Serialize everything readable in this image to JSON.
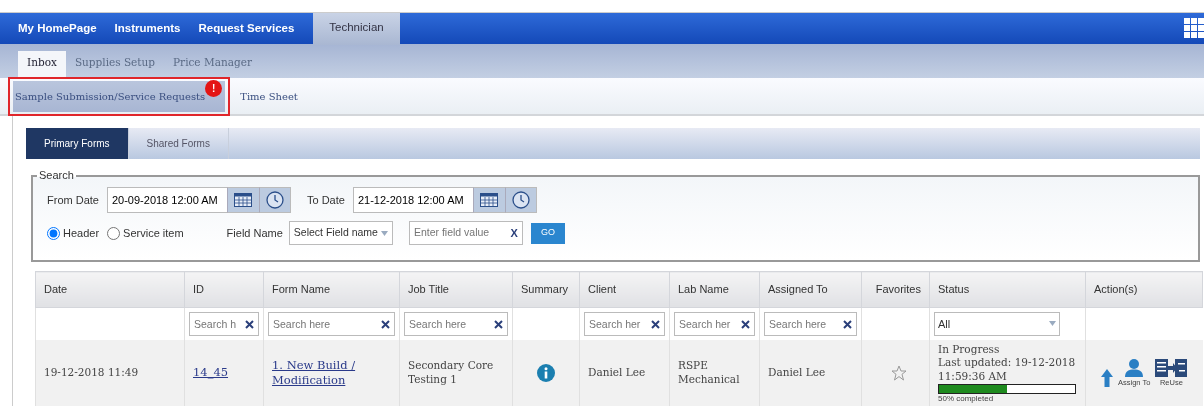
{
  "top_nav": [
    {
      "label": "My HomePage",
      "selected": false
    },
    {
      "label": "Instruments",
      "selected": false
    },
    {
      "label": "Request Services",
      "selected": false
    },
    {
      "label": "Technician",
      "selected": true
    }
  ],
  "sub_nav": [
    {
      "label": "Inbox",
      "selected": true
    },
    {
      "label": "Supplies Setup",
      "selected": false
    },
    {
      "label": "Price Manager",
      "selected": false
    }
  ],
  "section_tabs": [
    {
      "label": "Sample Submission/Service Requests",
      "selected": true,
      "badge": "!",
      "highlighted": true
    },
    {
      "label": "Time Sheet",
      "selected": false,
      "highlighted": false
    }
  ],
  "form_tabs": [
    {
      "label": "Primary Forms",
      "selected": true
    },
    {
      "label": "Shared Forms",
      "selected": false
    }
  ],
  "search": {
    "legend": "Search",
    "from_label": "From Date",
    "from_value": "20-09-2018 12:00 AM",
    "to_label": "To Date",
    "to_value": "21-12-2018 12:00 AM",
    "scope": [
      {
        "label": "Header",
        "selected": true
      },
      {
        "label": "Service item",
        "selected": false
      }
    ],
    "field_name_label": "Field Name",
    "field_select": "Select Field name",
    "value_placeholder": "Enter field value",
    "clear": "X",
    "go": "GO"
  },
  "table": {
    "columns": [
      "Date",
      "ID",
      "Form Name",
      "Job Title",
      "Summary",
      "Client",
      "Lab Name",
      "Assigned To",
      "Favorites",
      "Status",
      "Action(s)"
    ],
    "filters": [
      {
        "kind": "none"
      },
      {
        "kind": "text",
        "placeholder": "Search h"
      },
      {
        "kind": "text",
        "placeholder": "Search here"
      },
      {
        "kind": "text",
        "placeholder": "Search here"
      },
      {
        "kind": "none"
      },
      {
        "kind": "text",
        "placeholder": "Search her"
      },
      {
        "kind": "text",
        "placeholder": "Search her"
      },
      {
        "kind": "text",
        "placeholder": "Search here"
      },
      {
        "kind": "none"
      },
      {
        "kind": "select",
        "value": "All"
      },
      {
        "kind": "none"
      }
    ],
    "rows": [
      {
        "date": "19-12-2018 11:49",
        "id": "14_45",
        "form_name": "1. New Build / Modification",
        "job_title": "Secondary Core Testing 1",
        "client": "Daniel Lee",
        "lab_name": "RSPE Mechanical",
        "assigned_to": "Daniel Lee",
        "favorite": false,
        "status": {
          "state": "In Progress",
          "updated": "Last updated: 19-12-2018 11:59:36 AM",
          "level": 0.5,
          "progress_text": "50% completed"
        },
        "actions": [
          {
            "kind": "upload"
          },
          {
            "kind": "assign",
            "label": "Assign To"
          },
          {
            "kind": "reuse",
            "label": "ReUse"
          }
        ]
      }
    ]
  }
}
